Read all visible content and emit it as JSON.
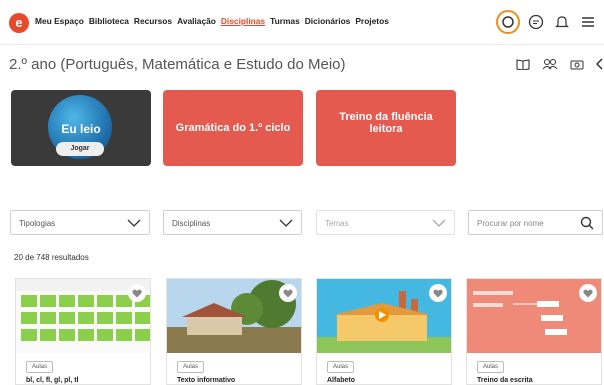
{
  "nav": {
    "items": [
      "Meu Espaço",
      "Biblioteca",
      "Recursos",
      "Avaliação",
      "Disciplinas",
      "Turmas",
      "Dicionários",
      "Projetos"
    ],
    "active": "Disciplinas"
  },
  "page": {
    "title": "2.º ano (Português, Matemática e Estudo do Meio)"
  },
  "featured": {
    "eu_leio": {
      "title": "Eu leio",
      "button": "Jogar"
    },
    "gramatica": "Gramática do 1.º ciclo",
    "treino": "Treino da fluência leitora"
  },
  "filters": {
    "tipologias": "Tipologias",
    "disciplinas": "Disciplinas",
    "temas": "Temas",
    "search_placeholder": "Procurar por nome"
  },
  "results": {
    "count": "20 de 748 resultados"
  },
  "tiles": [
    {
      "tag": "Aulas",
      "name": "bl, cl, fl, gl, pl, tl"
    },
    {
      "tag": "Aulas",
      "name": "Texto informativo"
    },
    {
      "tag": "Aulas",
      "name": "Alfabeto"
    },
    {
      "tag": "Aulas",
      "name": "Treino da escrita"
    }
  ],
  "colors": {
    "accent": "#e8492b",
    "card_red": "#e55a4f",
    "highlight_ring": "#f28c1b"
  }
}
